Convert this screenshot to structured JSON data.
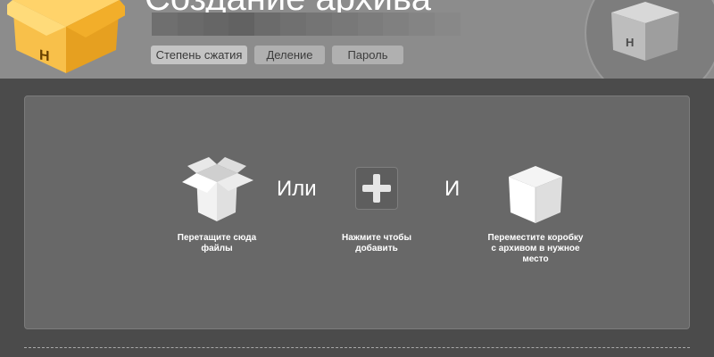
{
  "header": {
    "title": "Создание архива",
    "tabs": [
      {
        "label": "Степень сжатия",
        "active": true
      },
      {
        "label": "Деление",
        "active": false
      },
      {
        "label": "Пароль",
        "active": false
      }
    ],
    "logo_icon": "archive-box-icon",
    "preview_icon": "archive-box-preview-icon"
  },
  "steps": {
    "drag": {
      "caption": "Перетащите сюда файлы",
      "icon": "open-box-icon"
    },
    "or_word": "Или",
    "add": {
      "caption": "Нажмите чтобы добавить",
      "icon": "plus-icon"
    },
    "and_word": "И",
    "move": {
      "caption": "Переместите коробку с архивом в нужное место",
      "icon": "closed-box-icon"
    }
  },
  "colors": {
    "accent_box": "#f5b731",
    "header_bg": "#8c8c8c",
    "panel_bg": "#686868",
    "page_bg": "#4b4b4b"
  }
}
